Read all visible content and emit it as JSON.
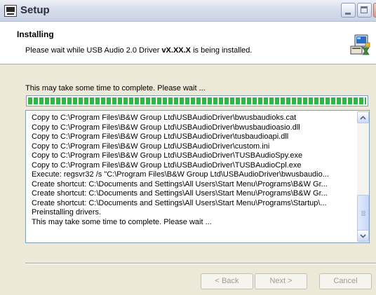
{
  "window": {
    "title": "Setup",
    "controls": [
      "minimize-icon",
      "maximize-icon",
      "close-icon"
    ]
  },
  "header": {
    "heading": "Installing",
    "subtext_prefix": "Please wait while USB Audio 2.0 Driver ",
    "subtext_version": "vX.XX.X",
    "subtext_suffix": " is being installed.",
    "icon": "installer-computer-icon"
  },
  "progress": {
    "label": "This may take some time to complete. Please wait ...",
    "fraction": 1.0,
    "color": "#2fb843"
  },
  "log": {
    "lines": [
      "Copy to C:\\Program Files\\B&W Group Ltd\\USBAudioDriver\\bwusbaudioks.cat",
      "Copy to C:\\Program Files\\B&W Group Ltd\\USBAudioDriver\\bwusbaudioasio.dll",
      "Copy to C:\\Program Files\\B&W Group Ltd\\USBAudioDriver\\tusbaudioapi.dll",
      "Copy to C:\\Program Files\\B&W Group Ltd\\USBAudioDriver\\custom.ini",
      "Copy to C:\\Program Files\\B&W Group Ltd\\USBAudioDriver\\TUSBAudioSpy.exe",
      "Copy to C:\\Program Files\\B&W Group Ltd\\USBAudioDriver\\TUSBAudioCpl.exe",
      "Execute: regsvr32 /s \"C:\\Program Files\\B&W Group Ltd\\USBAudioDriver\\bwusbaudio...",
      "Create shortcut: C:\\Documents and Settings\\All Users\\Start Menu\\Programs\\B&W Gr...",
      "Create shortcut: C:\\Documents and Settings\\All Users\\Start Menu\\Programs\\B&W Gr...",
      "Create shortcut: C:\\Documents and Settings\\All Users\\Start Menu\\Programs\\Startup\\...",
      "Preinstalling drivers.",
      "This may take some time to complete. Please wait ..."
    ]
  },
  "buttons": {
    "back": "< Back",
    "next": "Next >",
    "cancel": "Cancel"
  }
}
